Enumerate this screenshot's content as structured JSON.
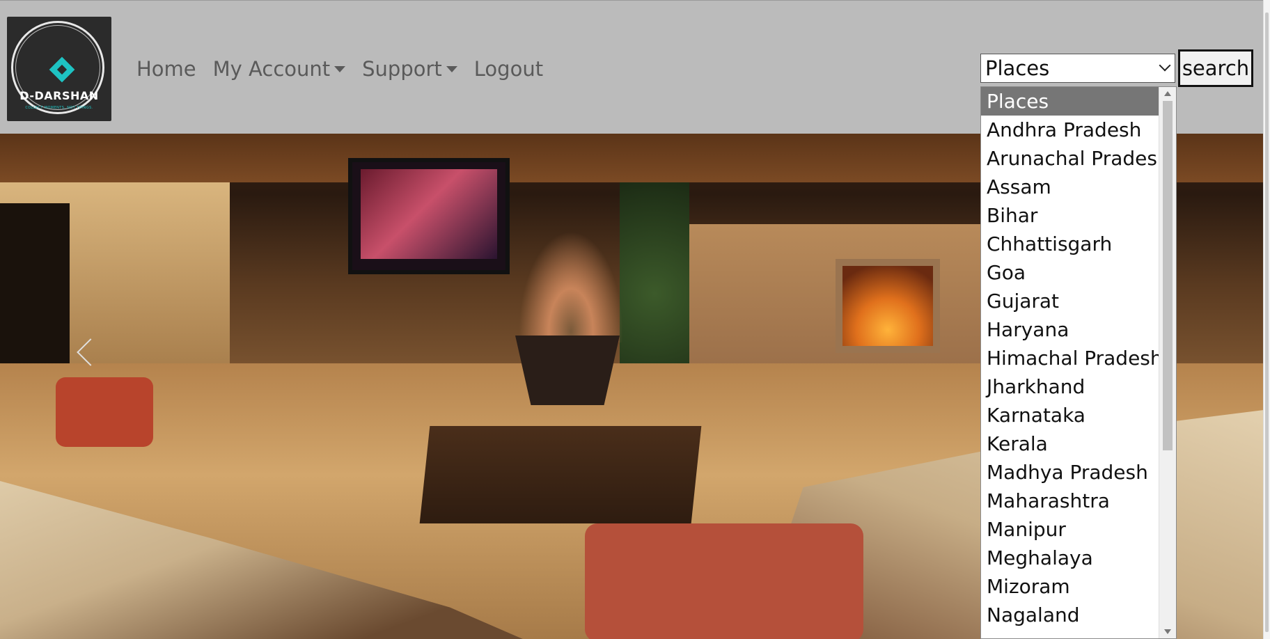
{
  "logo": {
    "brand": "D-DARSHAN",
    "tagline": "COLLECT MOMENTS, NOT THINGS."
  },
  "nav": {
    "items": [
      {
        "label": "Home",
        "dropdown": false
      },
      {
        "label": "My Account",
        "dropdown": true
      },
      {
        "label": "Support",
        "dropdown": true
      },
      {
        "label": "Logout",
        "dropdown": false
      }
    ]
  },
  "search": {
    "selected": "Places",
    "button_label": "search",
    "options": [
      "Places",
      "Andhra Pradesh",
      "Arunachal Pradesh",
      "Assam",
      "Bihar",
      "Chhattisgarh",
      "Goa",
      "Gujarat",
      "Haryana",
      "Himachal Pradesh",
      "Jharkhand",
      "Karnataka",
      "Kerala",
      "Madhya Pradesh",
      "Maharashtra",
      "Manipur",
      "Meghalaya",
      "Mizoram",
      "Nagaland"
    ]
  },
  "colors": {
    "navbar_bg": "#bbbbbb",
    "nav_text": "#5a5a5a",
    "accent": "#1ec3c3",
    "selected_option_bg": "#767676"
  },
  "icons": {
    "carousel_prev": "chevron-left-icon",
    "dropdown_caret": "caret-down-icon",
    "select_chevron": "chevron-down-icon"
  }
}
